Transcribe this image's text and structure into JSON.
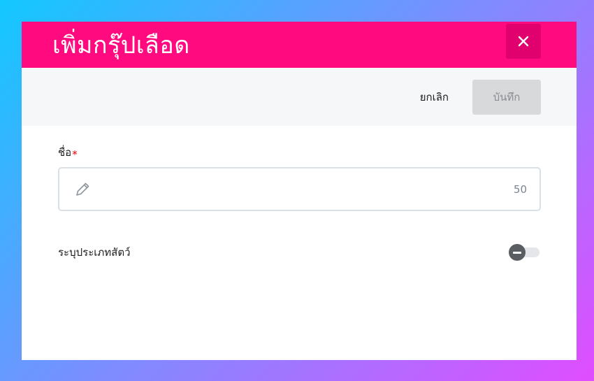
{
  "dialog": {
    "title": "เพิ่มกรุ๊ปเลือด",
    "close_icon": "close-icon"
  },
  "actions": {
    "cancel_label": "ยกเลิก",
    "save_label": "บันทึก"
  },
  "form": {
    "name_label": "ชื่อ",
    "required_mark": "*",
    "name_value": "",
    "name_counter": "50",
    "pencil_icon": "pencil-icon",
    "species_label": "ระบุประเภทสัตว์",
    "species_toggle_on": false
  },
  "colors": {
    "header": "#ff0a7f",
    "close_bg": "#e0006e",
    "save_disabled_bg": "#d8d9db"
  }
}
